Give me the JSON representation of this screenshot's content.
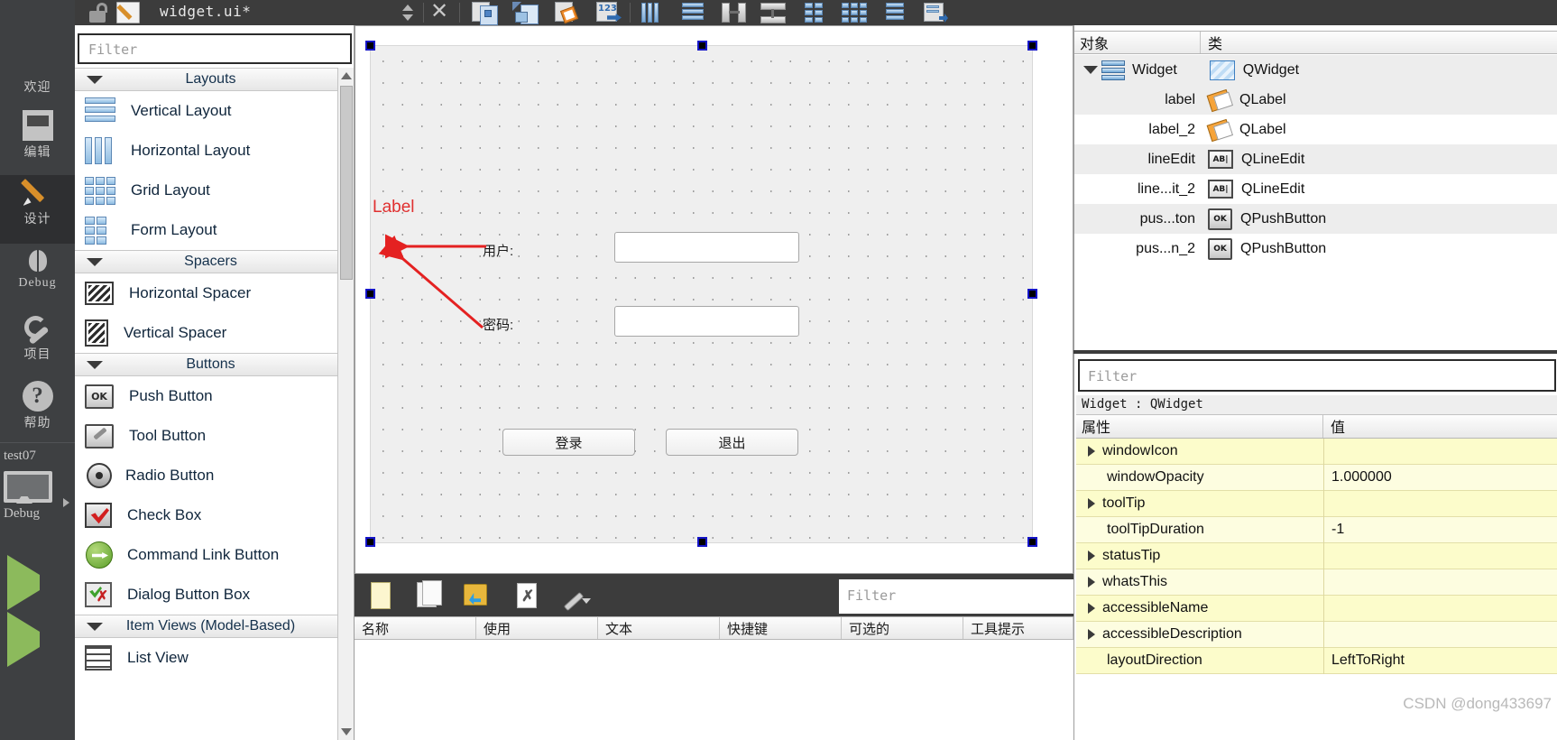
{
  "modebar": {
    "items": [
      {
        "label": "欢迎",
        "icon": "grid-icon",
        "selected": false
      },
      {
        "label": "编辑",
        "icon": "edit-lines-icon",
        "selected": false
      },
      {
        "label": "设计",
        "icon": "pencil-icon",
        "selected": true
      },
      {
        "label": "Debug",
        "icon": "bug-icon",
        "selected": false
      },
      {
        "label": "项目",
        "icon": "wrench-icon",
        "selected": false
      },
      {
        "label": "帮助",
        "icon": "question-mark-icon",
        "selected": false
      }
    ],
    "kit": {
      "project": "test07",
      "build_config": "Debug",
      "icon": "monitor-icon"
    }
  },
  "topbar": {
    "filename": "widget.ui*",
    "lock_icon": "unlock-icon",
    "file_icon": "ui-file-icon",
    "split_icon": "split-updown-icon",
    "close_icon": "close-icon",
    "tools": [
      "edit-widgets-icon",
      "edit-signals-slots-icon",
      "edit-buddies-icon",
      "edit-tab-order-icon",
      "layout-horizontally-icon",
      "layout-vertically-icon",
      "layout-horizontal-splitter-icon",
      "layout-vertical-splitter-icon",
      "layout-form-icon",
      "layout-grid-icon",
      "break-layout-icon",
      "adjust-size-icon"
    ]
  },
  "widgetbox": {
    "filter_placeholder": "Filter",
    "categories": [
      {
        "name": "Layouts",
        "items": [
          {
            "label": "Vertical Layout",
            "icon": "vertical-layout-icon"
          },
          {
            "label": "Horizontal Layout",
            "icon": "horizontal-layout-icon"
          },
          {
            "label": "Grid Layout",
            "icon": "grid-layout-icon"
          },
          {
            "label": "Form Layout",
            "icon": "form-layout-icon"
          }
        ]
      },
      {
        "name": "Spacers",
        "items": [
          {
            "label": "Horizontal Spacer",
            "icon": "horizontal-spacer-icon"
          },
          {
            "label": "Vertical Spacer",
            "icon": "vertical-spacer-icon"
          }
        ]
      },
      {
        "name": "Buttons",
        "items": [
          {
            "label": "Push Button",
            "icon": "push-button-icon"
          },
          {
            "label": "Tool Button",
            "icon": "tool-button-icon"
          },
          {
            "label": "Radio Button",
            "icon": "radio-button-icon"
          },
          {
            "label": "Check Box",
            "icon": "check-box-icon"
          },
          {
            "label": "Command Link Button",
            "icon": "command-link-button-icon"
          },
          {
            "label": "Dialog Button Box",
            "icon": "dialog-button-box-icon"
          }
        ]
      },
      {
        "name": "Item Views (Model-Based)",
        "items": [
          {
            "label": "List View",
            "icon": "list-view-icon"
          }
        ]
      }
    ]
  },
  "form": {
    "label_red": "Label",
    "fields": [
      {
        "label": "用户:",
        "value": "",
        "name": "lineEdit"
      },
      {
        "label": "密码:",
        "value": "",
        "name": "lineEdit_2"
      }
    ],
    "buttons": [
      {
        "label": "登录"
      },
      {
        "label": "退出"
      }
    ],
    "annotation_color": "#e03030"
  },
  "action_editor": {
    "filter_placeholder": "Filter",
    "toolbar_icons": [
      "new-action-icon",
      "copy-action-icon",
      "edit-action-icon",
      "delete-action-icon",
      "configure-icon"
    ],
    "columns": [
      "名称",
      "使用",
      "文本",
      "快捷键",
      "可选的",
      "工具提示"
    ]
  },
  "object_inspector": {
    "columns": [
      "对象",
      "类"
    ],
    "rows": [
      {
        "object": "Widget",
        "class": "QWidget",
        "icon": "qwidget-icon",
        "level": 0,
        "expanded": true
      },
      {
        "object": "label",
        "class": "QLabel",
        "icon": "qlabel-icon",
        "level": 1
      },
      {
        "object": "label_2",
        "class": "QLabel",
        "icon": "qlabel-icon",
        "level": 1
      },
      {
        "object": "lineEdit",
        "class": "QLineEdit",
        "icon": "qlineedit-icon",
        "level": 1
      },
      {
        "object": "line...it_2",
        "class": "QLineEdit",
        "icon": "qlineedit-icon",
        "level": 1
      },
      {
        "object": "pus...ton",
        "class": "QPushButton",
        "icon": "qpushbutton-icon",
        "level": 1
      },
      {
        "object": "pus...n_2",
        "class": "QPushButton",
        "icon": "qpushbutton-icon",
        "level": 1
      }
    ]
  },
  "property_editor": {
    "filter_placeholder": "Filter",
    "selection": "Widget : QWidget",
    "columns": [
      "属性",
      "值"
    ],
    "rows": [
      {
        "name": "windowIcon",
        "value": "",
        "expandable": true
      },
      {
        "name": "windowOpacity",
        "value": "1.000000",
        "expandable": false
      },
      {
        "name": "toolTip",
        "value": "",
        "expandable": true
      },
      {
        "name": "toolTipDuration",
        "value": "-1",
        "expandable": false
      },
      {
        "name": "statusTip",
        "value": "",
        "expandable": true
      },
      {
        "name": "whatsThis",
        "value": "",
        "expandable": true
      },
      {
        "name": "accessibleName",
        "value": "",
        "expandable": true
      },
      {
        "name": "accessibleDescription",
        "value": "",
        "expandable": true
      },
      {
        "name": "layoutDirection",
        "value": "LeftToRight",
        "expandable": false
      }
    ]
  },
  "watermark": "CSDN @dong433697"
}
